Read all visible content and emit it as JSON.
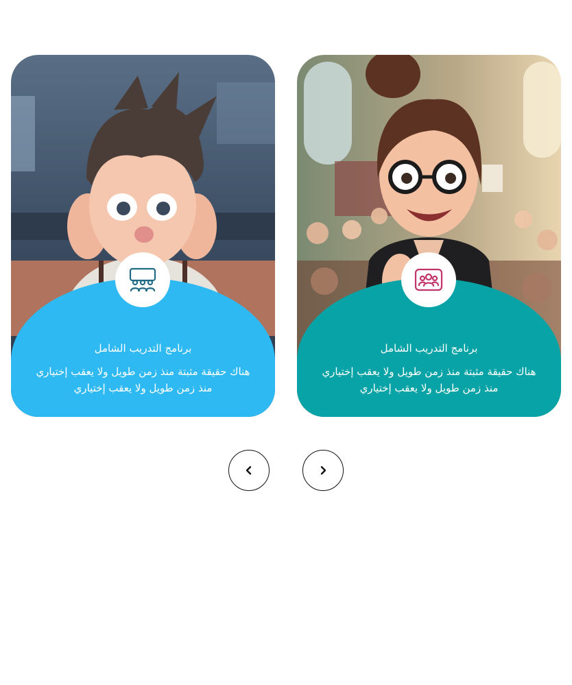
{
  "cards": [
    {
      "title": "برنامج التدريب الشامل",
      "description": "هناك حقيقة مثبتة منذ زمن طويل ولا يعقب إختياري منذ زمن طويل ولا يعقب إختياري",
      "icon": "classroom-icon",
      "panel_color": "#2fb9f2",
      "icon_color": "#1f6b86",
      "image": "worried cartoon boy at school desk"
    },
    {
      "title": "برنامج التدريب الشامل",
      "description": "هناك حقيقة مثبتة منذ زمن طويل ولا يعقب إختياري منذ زمن طويل ولا يعقب إختياري",
      "icon": "group-icon",
      "panel_color": "#07a3a6",
      "icon_color": "#c2336a",
      "image": "cartoon teacher in front of classroom"
    }
  ],
  "navigation": {
    "prev_icon": "chevron-left-icon",
    "next_icon": "chevron-right-icon"
  }
}
